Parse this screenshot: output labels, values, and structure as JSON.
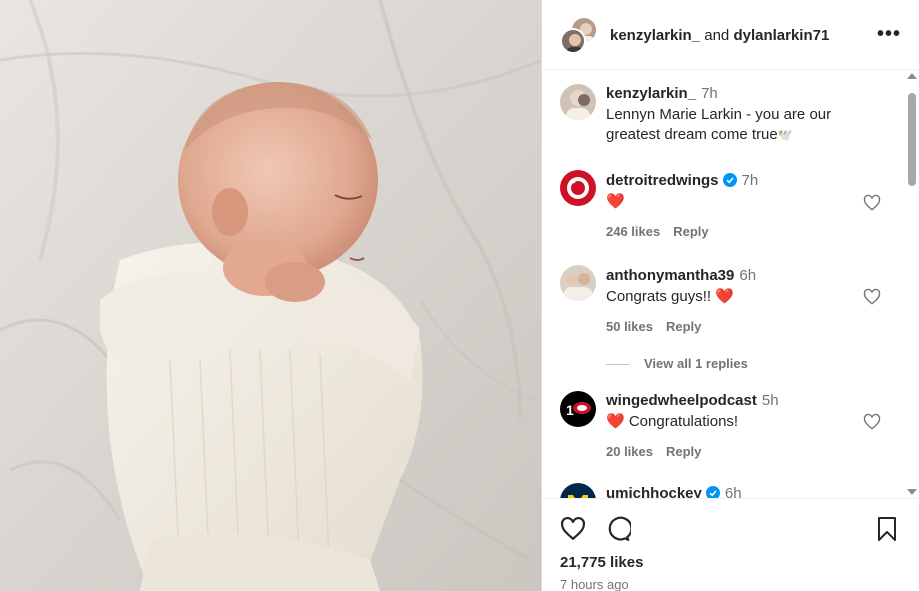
{
  "header": {
    "user1": "kenzylarkin_",
    "conjunction": "and",
    "user2": "dylanlarkin71",
    "more_label": "•••"
  },
  "caption": {
    "username": "kenzylarkin_",
    "time": "7h",
    "line1": "Lennyn Marie Larkin - you are our",
    "line2": "greatest dream come true",
    "emoji": "🕊️"
  },
  "comments": [
    {
      "username": "detroitredwings",
      "verified": true,
      "time": "7h",
      "text": "❤️",
      "likes": "246 likes",
      "reply": "Reply"
    },
    {
      "username": "anthonymantha39",
      "verified": false,
      "time": "6h",
      "text": "Congrats guys!! ❤️",
      "likes": "50 likes",
      "reply": "Reply",
      "view_replies": "View all 1 replies"
    },
    {
      "username": "wingedwheelpodcast",
      "verified": false,
      "time": "5h",
      "text": "❤️ Congratulations!",
      "likes": "20 likes",
      "reply": "Reply"
    },
    {
      "username": "umichhockey",
      "verified": true,
      "time": "6h"
    }
  ],
  "footer": {
    "likes": "21,775 likes",
    "time_ago": "7 hours ago"
  },
  "colors": {
    "verified_blue": "#0095f6",
    "heart_red": "#ff3040",
    "redwings_red": "#ce1126",
    "michigan_yellow": "#ffcb05"
  },
  "icons": [
    "heart-icon",
    "comment-icon",
    "bookmark-icon",
    "more-icon",
    "verified-icon"
  ]
}
